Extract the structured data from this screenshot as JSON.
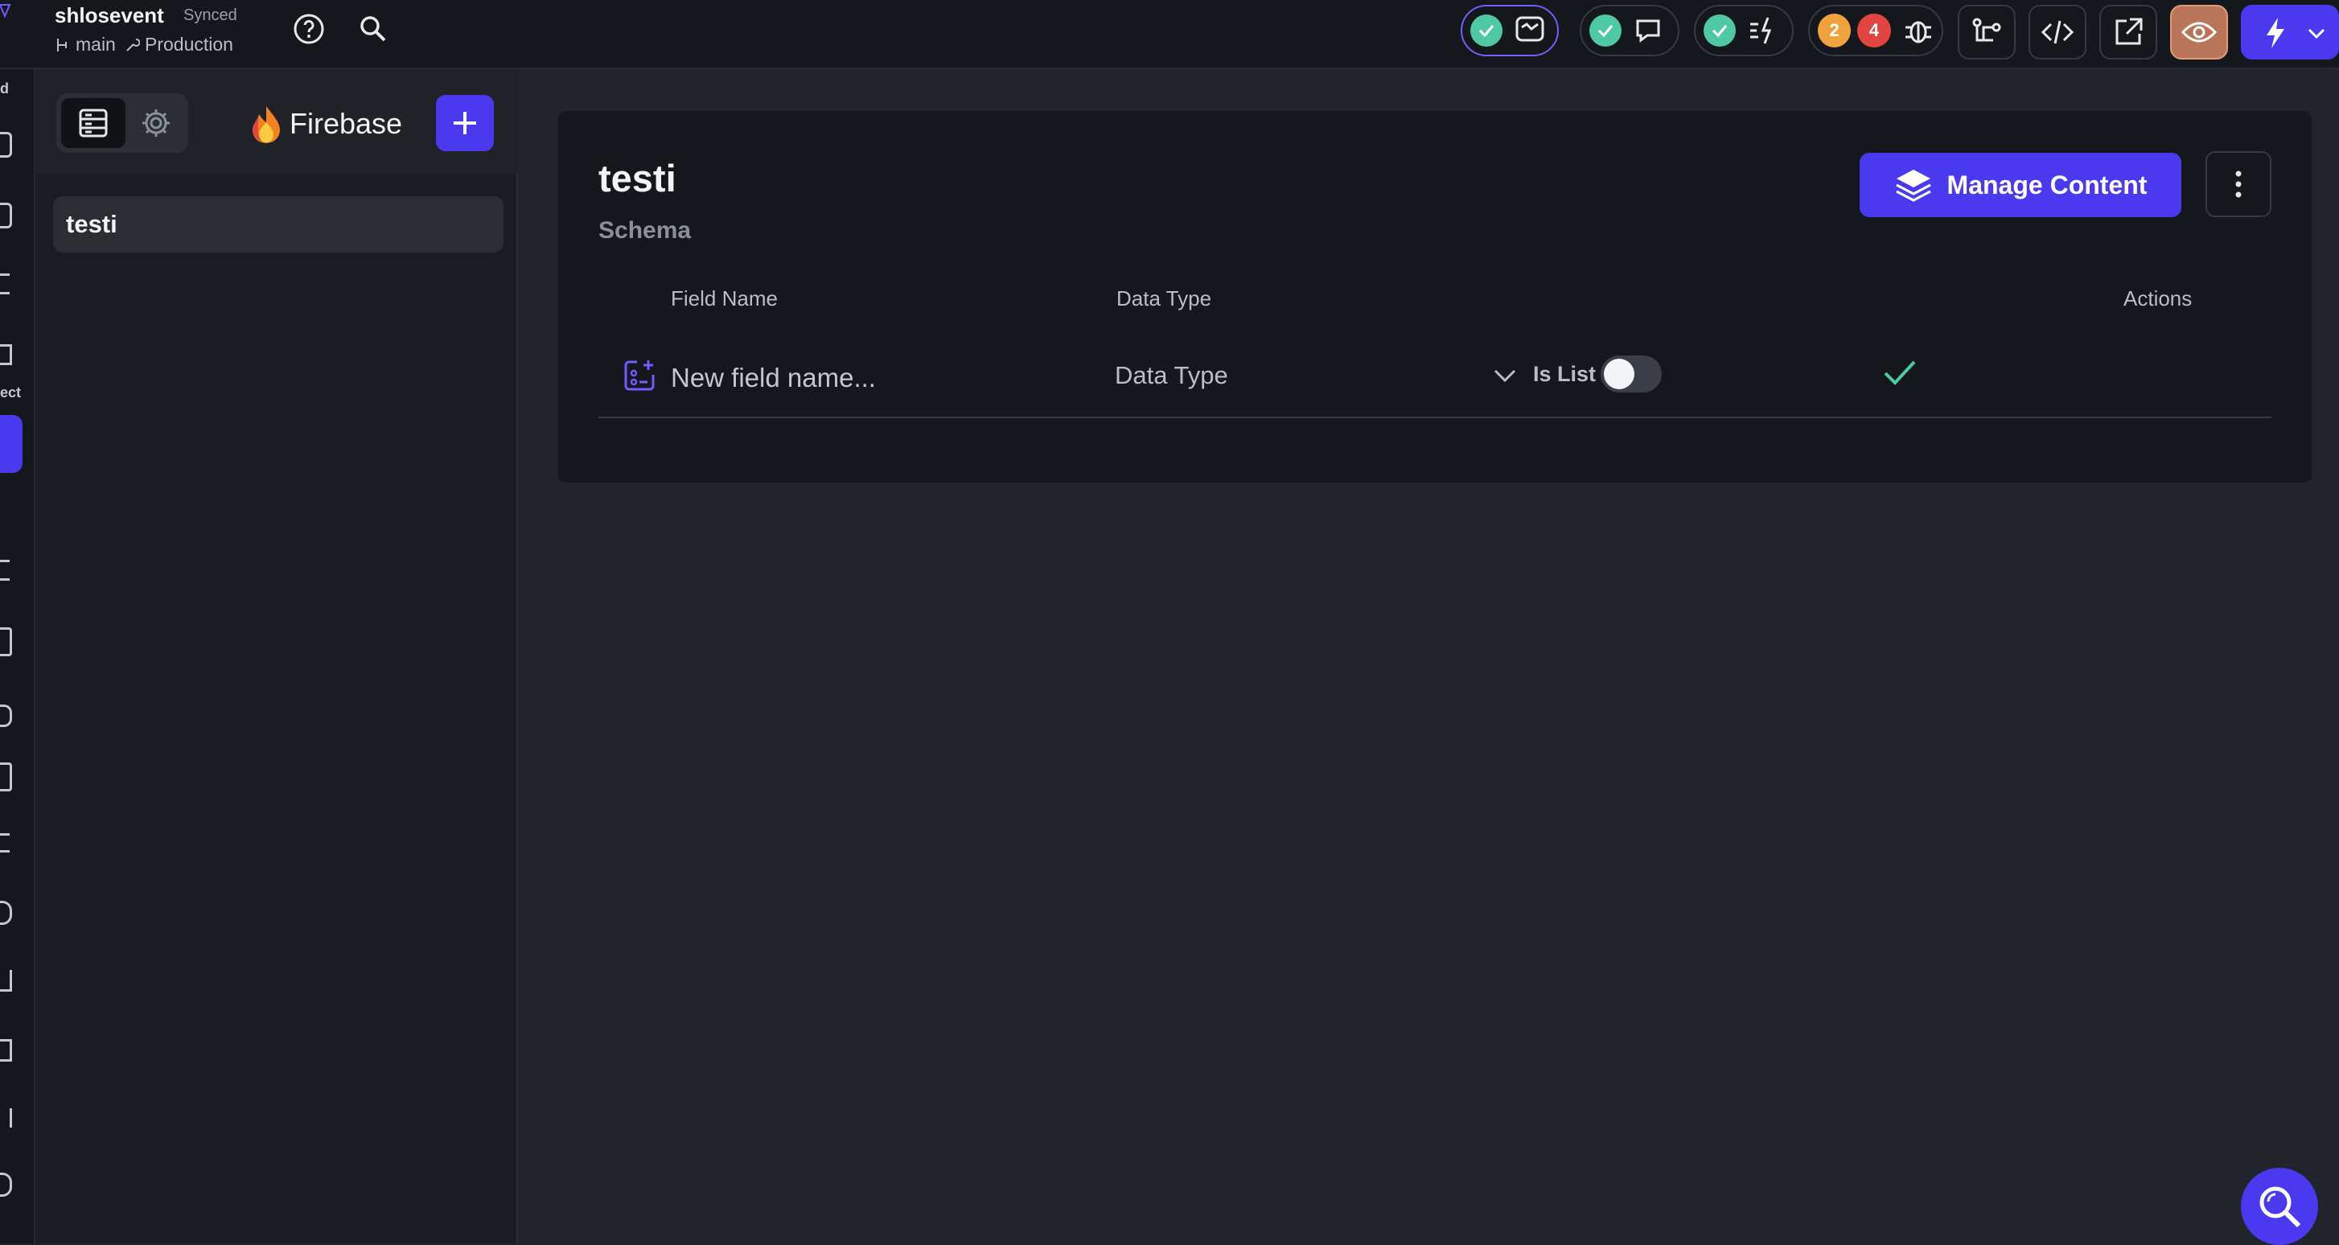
{
  "topbar": {
    "project_name": "shlosevent",
    "sync_status": "Synced",
    "branch": "main",
    "environment": "Production",
    "issue_badges": {
      "warnings": "2",
      "errors": "4"
    }
  },
  "sidebar": {
    "brand": "Firebase",
    "collections": [
      {
        "label": "testi"
      }
    ]
  },
  "main": {
    "collection_title": "testi",
    "section_label": "Schema",
    "manage_button": "Manage Content",
    "table": {
      "headers": {
        "field_name": "Field Name",
        "data_type": "Data Type",
        "actions": "Actions"
      },
      "new_field_placeholder": "New field name...",
      "data_type_placeholder": "Data Type",
      "is_list_label": "Is List",
      "is_list_value": false
    }
  },
  "colors": {
    "accent": "#4b39ef",
    "success": "#4fc9a4",
    "warning": "#f0a23c",
    "error": "#e0463f",
    "background": "#21252b",
    "card": "#14171b"
  },
  "icons": [
    "checkmark-icon",
    "flow-icon",
    "chat-icon",
    "lightning-list-icon",
    "bug-icon",
    "branch-icon",
    "code-icon",
    "open-external-icon",
    "eye-icon",
    "bolt-icon",
    "chevron-down-icon",
    "help-icon",
    "search-icon",
    "database-icon",
    "gear-icon",
    "plus-icon",
    "firebase-flame-icon",
    "layers-icon",
    "more-vertical-icon",
    "add-field-icon"
  ]
}
